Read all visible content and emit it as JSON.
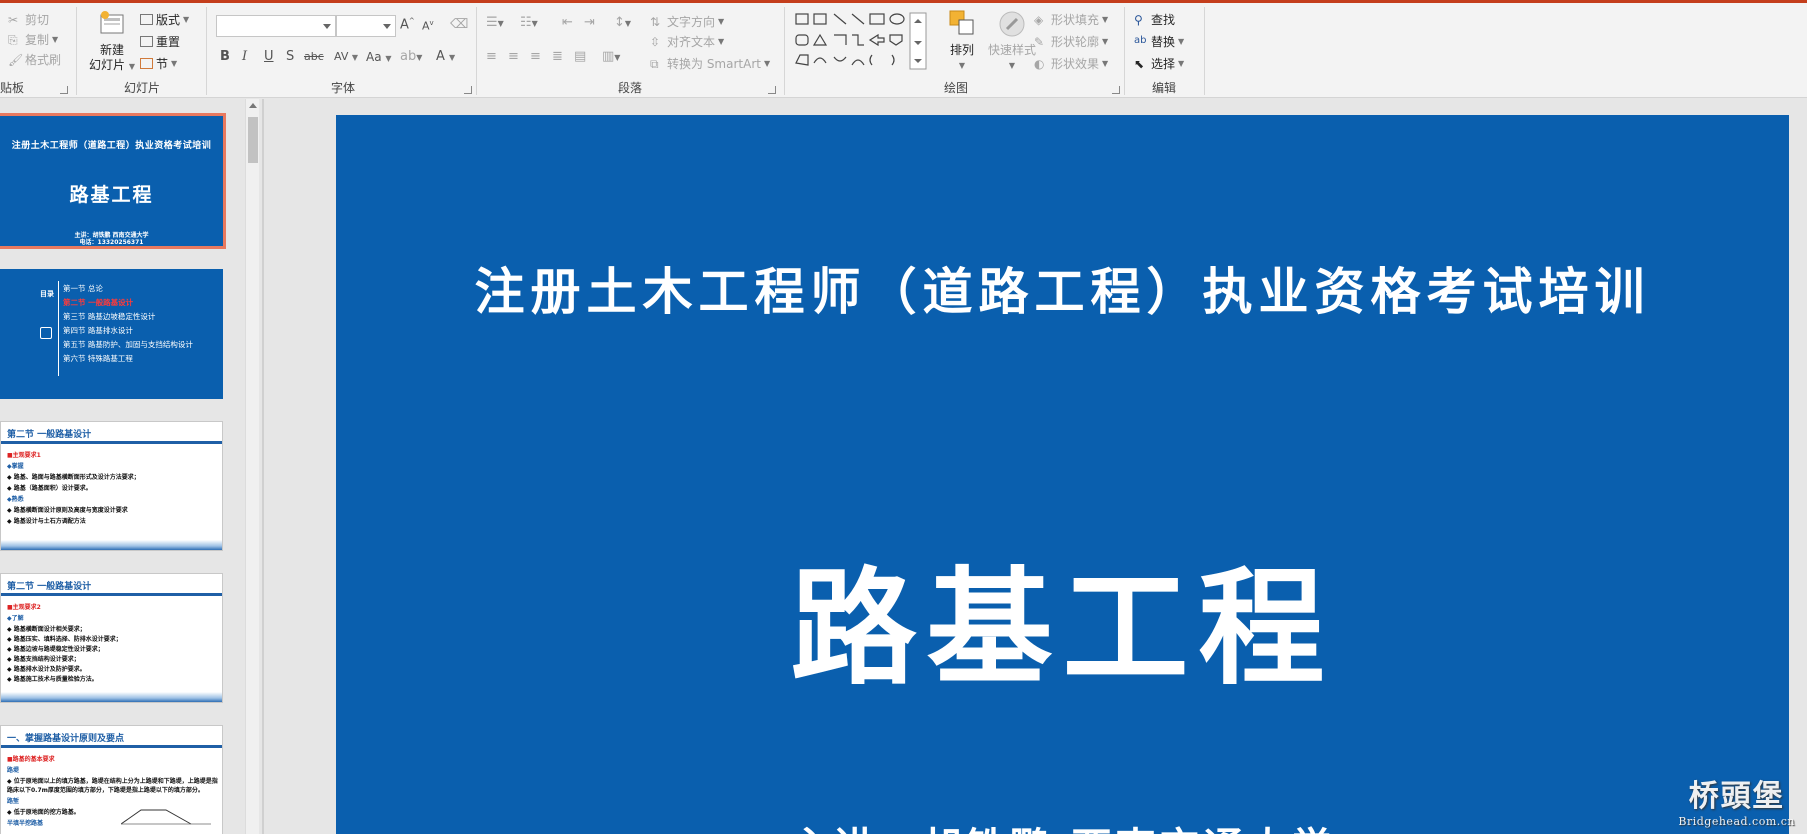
{
  "ribbon": {
    "clipboard": {
      "cut": "剪切",
      "copy": "复制",
      "format_painter": "格式刷",
      "group_label": "贴板"
    },
    "slides": {
      "new_slide_1": "新建",
      "new_slide_2": "幻灯片",
      "layout": "版式",
      "reset": "重置",
      "section": "节",
      "group_label": "幻灯片"
    },
    "font": {
      "group_label": "字体",
      "bold": "B",
      "italic": "I",
      "underline": "U",
      "shadow": "S",
      "strike": "abc",
      "spacing": "AV",
      "case": "Aa",
      "color": "A",
      "grow": "A",
      "shrink": "A"
    },
    "paragraph": {
      "text_direction": "文字方向",
      "align_text": "对齐文本",
      "smartart": "转换为 SmartArt",
      "group_label": "段落"
    },
    "drawing": {
      "arrange": "排列",
      "quick_styles": "快速样式",
      "shape_fill": "形状填充",
      "shape_outline": "形状轮廓",
      "shape_effects": "形状效果",
      "group_label": "绘图"
    },
    "editing": {
      "find": "查找",
      "replace": "替换",
      "select": "选择",
      "group_label": "编辑"
    }
  },
  "thumbnails": {
    "t1": {
      "line": "注册土木工程师（道路工程）执业资格考试培训",
      "title": "路基工程",
      "author1": "主讲：胡铁鹏  西南交通大学",
      "author2": "电话：13320256371"
    },
    "t2": {
      "label": "目录",
      "items": [
        "第一节 总论",
        "第二节 一般路基设计",
        "第三节 路基边坡稳定性设计",
        "第四节 路基排水设计",
        "第五节 路基防护、加固与支挡结构设计",
        "第六节 特殊路基工程"
      ]
    },
    "t3": {
      "head": "第二节 一般路基设计",
      "lines": [
        "■主观要求1",
        "◆掌握",
        "  ◆ 路基、路面与路基横断面形式及设计方法要求；",
        "  ◆ 路基（路基面积）设计要求。",
        "◆熟悉",
        "  ◆ 路基横断面设计原则及高度与宽度设计要求",
        "  ◆ 路基设计与土石方调配方法"
      ]
    },
    "t4": {
      "head": "第二节 一般路基设计",
      "lines": [
        "■主观要求2",
        "◆了解",
        "  ◆ 路基横断面设计相关要求；",
        "  ◆ 路基压实、填料选择、防排水设计要求；",
        "  ◆ 路基边坡与路堤稳定性设计要求；",
        "  ◆ 路基支挡结构设计要求；",
        "  ◆ 路基排水设计及防护要求。",
        "  ◆ 路基施工技术与质量检验方法。"
      ]
    },
    "t5": {
      "head": "一、掌握路基设计原则及要点",
      "lines": [
        "■路基的基本要求",
        "路堤",
        "  ◆ 位于原地面以上的填方路基，路堤在结构上分为上路堤和下路堤，上路堤是指",
        "    路床以下0.7m厚度范围的填方部分，下路堤是指上路堤以下的填方部分。",
        "路堑",
        "  ◆ 低于原地面的挖方路基。",
        "半填半挖路基"
      ]
    }
  },
  "slide": {
    "subtitle": "注册土木工程师（道路工程）执业资格考试培训",
    "title": "路基工程",
    "author": "主讲：胡铁鹏  西南交通大学"
  },
  "watermark": {
    "line1": "桥頭堡",
    "line2": "Bridgehead.com.cn"
  }
}
